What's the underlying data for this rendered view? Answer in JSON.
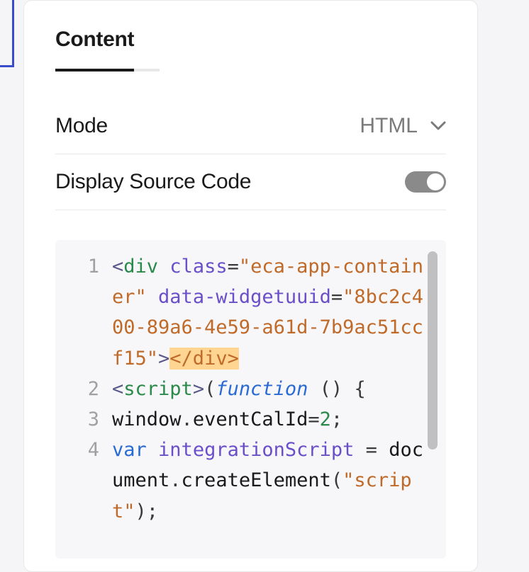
{
  "tabs": {
    "content": "Content"
  },
  "settings": {
    "mode_label": "Mode",
    "mode_value": "HTML",
    "display_source_label": "Display Source Code",
    "display_source_on": true
  },
  "code": {
    "lines": [
      {
        "n": "1",
        "tokens": [
          {
            "t": "<",
            "c": "punct"
          },
          {
            "t": "div",
            "c": "tag"
          },
          {
            "t": " ",
            "c": ""
          },
          {
            "t": "class",
            "c": "attr"
          },
          {
            "t": "=",
            "c": "punct2"
          },
          {
            "t": "\"eca-app-container\"",
            "c": "string"
          },
          {
            "t": " ",
            "c": ""
          },
          {
            "t": "data-widgetuuid",
            "c": "attr"
          },
          {
            "t": "=",
            "c": "punct2"
          },
          {
            "t": "\"8bc2c400-89a6-4e59-a61d-7b9ac51ccf15\"",
            "c": "string"
          },
          {
            "t": ">",
            "c": "punct"
          },
          {
            "t": "</div>",
            "c": "highlight"
          }
        ]
      },
      {
        "n": "2",
        "tokens": [
          {
            "t": "<",
            "c": "punct"
          },
          {
            "t": "script",
            "c": "tag"
          },
          {
            "t": ">",
            "c": "punct"
          },
          {
            "t": "(",
            "c": "punct2"
          },
          {
            "t": "function",
            "c": "keyword"
          },
          {
            "t": " ",
            "c": ""
          },
          {
            "t": "(",
            "c": "punct2"
          },
          {
            "t": ")",
            "c": "punct2"
          },
          {
            "t": " ",
            "c": ""
          },
          {
            "t": "{",
            "c": "punct2"
          }
        ]
      },
      {
        "n": "3",
        "tokens": [
          {
            "t": "window",
            "c": "ident"
          },
          {
            "t": ".",
            "c": "punct2"
          },
          {
            "t": "eventCalId",
            "c": "ident"
          },
          {
            "t": "=",
            "c": "punct2"
          },
          {
            "t": "2",
            "c": "num"
          },
          {
            "t": ";",
            "c": "punct2"
          }
        ]
      },
      {
        "n": "4",
        "tokens": [
          {
            "t": "var",
            "c": "var"
          },
          {
            "t": " ",
            "c": ""
          },
          {
            "t": "integrationScript",
            "c": "attr"
          },
          {
            "t": " ",
            "c": ""
          },
          {
            "t": "=",
            "c": "punct2"
          },
          {
            "t": " ",
            "c": ""
          },
          {
            "t": "document",
            "c": "ident"
          },
          {
            "t": ".",
            "c": "punct2"
          },
          {
            "t": "createElement",
            "c": "ident"
          },
          {
            "t": "(",
            "c": "punct2"
          },
          {
            "t": "\"script\"",
            "c": "string"
          },
          {
            "t": ")",
            "c": "punct2"
          },
          {
            "t": ";",
            "c": "punct2"
          }
        ]
      }
    ]
  }
}
